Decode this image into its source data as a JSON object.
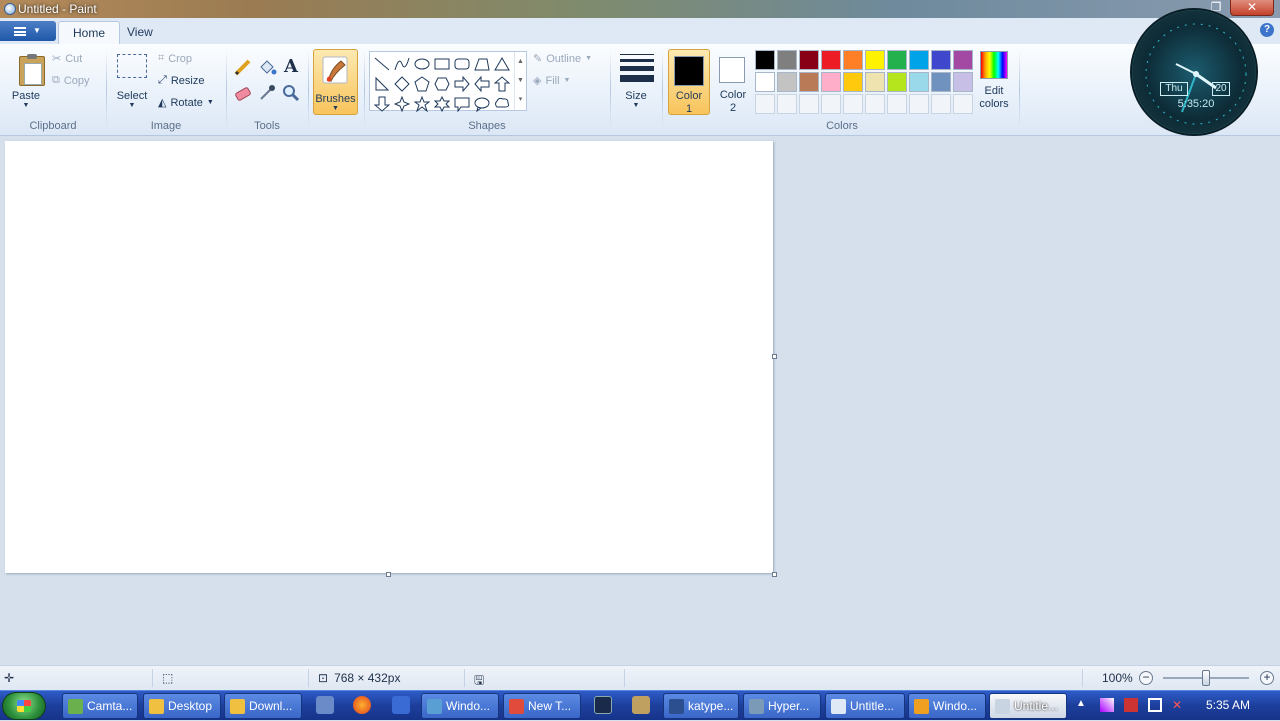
{
  "window": {
    "title": "Untitled - Paint",
    "controls": {
      "restore": "❐",
      "close": "✕"
    }
  },
  "tabs": [
    {
      "label": "Home",
      "active": true
    },
    {
      "label": "View",
      "active": false
    }
  ],
  "help": "?",
  "ribbon": {
    "clipboard": {
      "group": "Clipboard",
      "paste": "Paste",
      "cut": "Cut",
      "copy": "Copy"
    },
    "image": {
      "group": "Image",
      "select": "Select",
      "crop": "Crop",
      "resize": "Resize",
      "rotate": "Rotate"
    },
    "tools": {
      "group": "Tools",
      "text_tool_glyph": "A"
    },
    "brushes": {
      "label": "Brushes"
    },
    "shapes": {
      "group": "Shapes",
      "outline": "Outline",
      "fill": "Fill"
    },
    "size": {
      "label": "Size"
    },
    "colors": {
      "group": "Colors",
      "color1": {
        "label_line1": "Color",
        "label_line2": "1",
        "value": "#000000"
      },
      "color2": {
        "label_line1": "Color",
        "label_line2": "2",
        "value": "#ffffff"
      },
      "palette_row1": [
        "#000000",
        "#7f7f7f",
        "#880015",
        "#ed1c24",
        "#ff7f27",
        "#fff200",
        "#22b14c",
        "#00a2e8",
        "#3f48cc",
        "#a349a4"
      ],
      "palette_row2": [
        "#ffffff",
        "#c3c3c3",
        "#b97a57",
        "#ffaec9",
        "#ffc90e",
        "#efe4b0",
        "#b5e61d",
        "#99d9ea",
        "#7092be",
        "#c8bfe7"
      ],
      "edit_line1": "Edit",
      "edit_line2": "colors"
    }
  },
  "gadget": {
    "day": "Thu",
    "date": "20",
    "time": "5:35:20"
  },
  "statusbar": {
    "dimensions": "768 × 432px",
    "zoom": "100%"
  },
  "taskbar": {
    "tasks": [
      {
        "label": "Camta...",
        "color": "#6ab04c"
      },
      {
        "label": "Desktop",
        "color": "#f0c040"
      },
      {
        "label": "Downl...",
        "color": "#f0c040"
      },
      {
        "label": "Windo...",
        "color": "#5a9fd4"
      },
      {
        "label": "New T...",
        "color": "#e04b3c"
      },
      {
        "label": "katype...",
        "color": "#2b4f8f"
      },
      {
        "label": "Hyper...",
        "color": "#7a9ab8"
      },
      {
        "label": "Untitle...",
        "color": "#dfe9f5"
      },
      {
        "label": "Windo...",
        "color": "#f0a020"
      },
      {
        "label": "Untitle...",
        "color": "#c9d4e2"
      }
    ],
    "clock": "5:35 AM"
  }
}
